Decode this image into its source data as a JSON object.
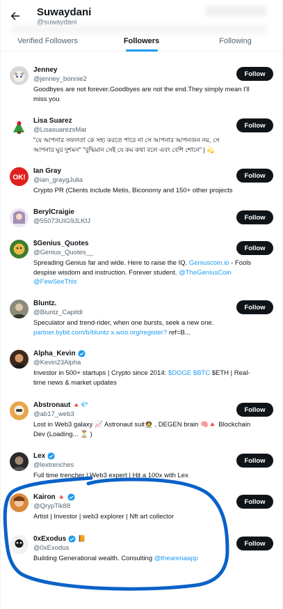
{
  "header": {
    "title": "Suwaydani",
    "handle": "@suwaydani"
  },
  "tabs": [
    {
      "label": "Verified Followers",
      "active": false
    },
    {
      "label": "Followers",
      "active": true
    },
    {
      "label": "Following",
      "active": false
    }
  ],
  "follow_label": "Follow",
  "colors": {
    "accent": "#1d9bf0",
    "button_bg": "#0f1419",
    "highlight": "#0a62c8"
  },
  "users": [
    {
      "name": "Jenney",
      "handle": "@jenney_bonnie2",
      "bio": [
        "Goodbyes are not forever.Goodbyes are not the end.They simply mean I'll",
        "miss you"
      ],
      "verified": false
    },
    {
      "name": "Lisa Suarez",
      "handle": "@LisasuarezsMar",
      "bio": [
        "\"যে আপনার সফলতা কে সহ্য করতে পারে না সে আপনার আপনজন নয়, সে",
        "আপনার ঘুর দুশমন\" \"বুদ্ধিমান সেই যে কম কথা বলে এবং বেশি শোনে\" | 💫"
      ],
      "verified": false
    },
    {
      "name": "Ian Gray",
      "handle": "@ian_graygJulia",
      "bio": [
        "Crypto PR (Clients include Metis, Biconomy and 150+ other projects"
      ],
      "verified": false
    },
    {
      "name": "BerylCraigie",
      "handle": "@55073UIG9JLKfJ",
      "bio": [],
      "verified": false
    },
    {
      "name": "$Genius_Quotes",
      "handle": "@Genius_Quotes__",
      "bio_pre": "Spreading Genius far and wide. Here to raise the IQ. ",
      "bio_link1": "Geniuscoin.io",
      "bio_mid": " - Fools",
      "bio_line2": "despise wisdom and instruction. Forever student. ",
      "bio_link2": "@TheGeniusCoin",
      "bio_link3": "@FewSeeThis",
      "verified": false
    },
    {
      "name": "Bluntz.",
      "handle": "@Bluntz_Capitdl",
      "bio_line1": "Speculator and trend-rider, when one bursts, seek a new one.",
      "bio_link": "partner.bybit.com/b/bluntz x.woo.org/register?",
      "bio_tail": " ref=B...",
      "verified": false
    },
    {
      "name": "Alpha_Kevin",
      "handle": "@Kevin23Alpha",
      "bio_pre": "Investor in 500+ startups | Crypto since 2014: ",
      "bio_link": "$DOGE $BTC",
      "bio_mid": " $ETH | Real-",
      "bio_line2": "time news & market updates",
      "verified": true
    },
    {
      "name": "Abstronaut",
      "handle": "@ab17_web3",
      "bio": [
        "Lost in Web3 galaxy 📈 Astronaut suit🧑‍🚀 , DEGEN brain 🧠🔺 Blockchain",
        "Dev (Loading... ⏳ )"
      ],
      "name_emoji": "🔺💎",
      "verified": false
    },
    {
      "name": "Lex",
      "handle": "@lextrenches",
      "bio": [
        "Full time trencher | Web3 expert | Hit a 100x with Lex"
      ],
      "verified": true
    },
    {
      "name": "Kairon",
      "handle": "@QrypTik88",
      "bio": [
        "Artist | Investor | web3 explorer | Nft art collector"
      ],
      "name_emoji": "🔺",
      "verified": true
    },
    {
      "name": "0xExodus",
      "handle": "@0xExodus",
      "bio_pre": "Building Generational wealth. Consulting ",
      "bio_link": "@thearenaapp",
      "name_emoji": "📙",
      "verified": true
    }
  ]
}
